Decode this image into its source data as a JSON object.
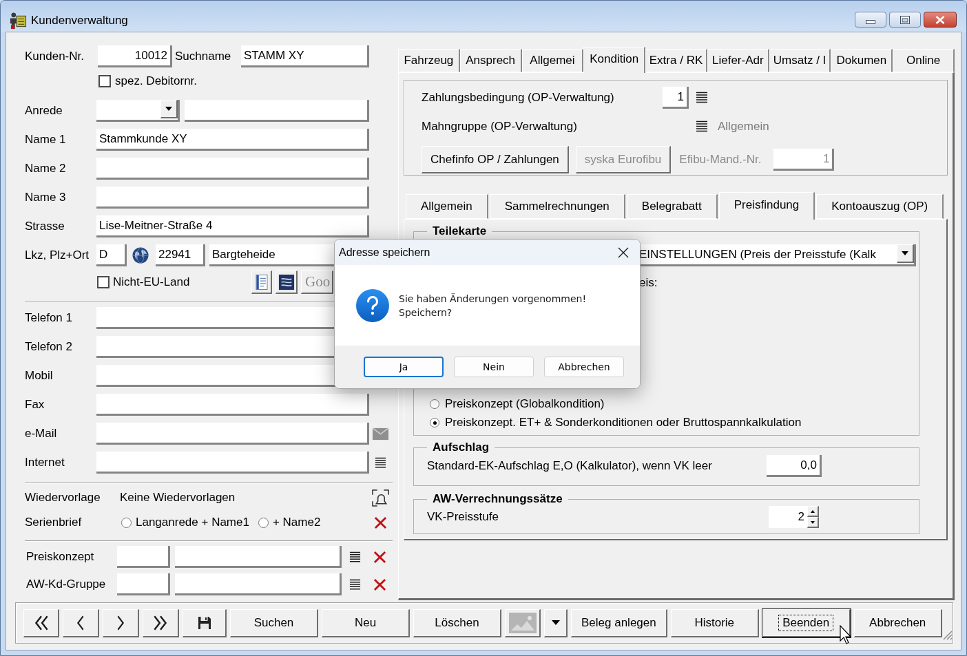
{
  "window": {
    "title": "Kundenverwaltung"
  },
  "customer": {
    "customer_number": {
      "label": "Kunden-Nr.",
      "value": "10012"
    },
    "search_name": {
      "label": "Suchname",
      "value": "STAMM XY"
    },
    "special_debtor_number": {
      "label": "spez. Debitornr.",
      "checked": false
    },
    "salutation": {
      "label": "Anrede"
    },
    "names": [
      {
        "label": "Name 1",
        "value": "Stammkunde XY"
      },
      {
        "label": "Name 2"
      },
      {
        "label": "Name 3"
      }
    ],
    "street": {
      "label": "Strasse",
      "value": "Lise-Meitner-Straße 4"
    },
    "location": {
      "label": "Lkz, Plz+Ort",
      "country_code": "D",
      "postal_code": "22941",
      "city": "Bargteheide"
    },
    "non_eu_country": {
      "label": "Nicht-EU-Land",
      "checked": false
    },
    "map_link": {
      "label": "Goo"
    },
    "contacts": [
      {
        "label": "Telefon 1",
        "kind": "phone"
      },
      {
        "label": "Telefon 2",
        "kind": "phone"
      },
      {
        "label": "Mobil",
        "kind": "phone"
      },
      {
        "label": "Fax",
        "kind": "phone"
      },
      {
        "label": "e-Mail",
        "kind": "email"
      },
      {
        "label": "Internet",
        "kind": "web"
      }
    ],
    "follow_up": {
      "label": "Wiedervorlage",
      "value": "Keine Wiedervorlagen"
    },
    "serial_letter": {
      "label": "Serienbrief",
      "options": [
        {
          "label": "Langanrede + Name1",
          "selected": false
        },
        {
          "label": "+ Name2",
          "selected": false
        }
      ]
    },
    "lookups": [
      {
        "label": "Preiskonzept"
      },
      {
        "label": "AW-Kd-Gruppe"
      }
    ]
  },
  "tabs": [
    {
      "label": "Fahrzeug",
      "selected": false
    },
    {
      "label": "Ansprech",
      "selected": false
    },
    {
      "label": "Allgemei",
      "selected": false
    },
    {
      "label": "Kondition",
      "selected": true
    },
    {
      "label": "Extra / RK",
      "selected": false
    },
    {
      "label": "Liefer-Adr",
      "selected": false
    },
    {
      "label": "Umsatz / I",
      "selected": false
    },
    {
      "label": "Dokumen",
      "selected": false
    },
    {
      "label": "Online",
      "selected": false
    }
  ],
  "payment": {
    "terms": {
      "label": "Zahlungsbedingung (OP-Verwaltung)",
      "value": "1"
    },
    "dunning_group": {
      "label": "Mahngruppe (OP-Verwaltung)",
      "value": "Allgemein"
    },
    "buttons": [
      {
        "label": "Chefinfo OP / Zahlungen",
        "disabled": false
      },
      {
        "label": "syska Eurofibu",
        "disabled": true
      }
    ],
    "accounting_client": {
      "label": "Efibu-Mand.-Nr.",
      "value": "1",
      "disabled": true
    }
  },
  "sub_tabs": [
    {
      "label": "Allgemein",
      "selected": false
    },
    {
      "label": "Sammelrechnungen",
      "selected": false
    },
    {
      "label": "Belegrabatt",
      "selected": false
    },
    {
      "label": "Preisfindung",
      "selected": true
    },
    {
      "label": "Kontoauszug (OP)",
      "selected": false
    }
  ],
  "parts_card": {
    "title": "Teilekarte",
    "dropdown_value": "EINSTELLUNGEN (Preis der Preisstufe (Kalk",
    "text_fragment": "eis:",
    "options": [
      {
        "label": "Preiskonzept (Globalkondition)",
        "selected": false
      },
      {
        "label": "Preiskonzept. ET+ & Sonderkonditionen oder Bruttospannkalkulation",
        "selected": true
      }
    ]
  },
  "surcharge": {
    "title": "Aufschlag",
    "label": "Standard-EK-Aufschlag E,O (Kalkulator), wenn VK leer",
    "value": "0,0"
  },
  "labour_rates": {
    "title": "AW-Verrechnungssätze",
    "label": "VK-Preisstufe",
    "value": "2"
  },
  "toolbar": [
    {
      "kind": "first",
      "focused": false
    },
    {
      "kind": "previous",
      "focused": false
    },
    {
      "kind": "next",
      "focused": false
    },
    {
      "kind": "last",
      "focused": false
    },
    {
      "kind": "save",
      "focused": false
    },
    {
      "kind": "text",
      "label": "Suchen",
      "focused": false
    },
    {
      "kind": "text",
      "label": "Neu",
      "focused": false
    },
    {
      "kind": "text",
      "label": "Löschen",
      "focused": false
    },
    {
      "kind": "picture",
      "focused": false
    },
    {
      "kind": "dropdown",
      "focused": false
    },
    {
      "kind": "text",
      "label": "Beleg anlegen",
      "focused": false
    },
    {
      "kind": "text",
      "label": "Historie",
      "focused": false
    },
    {
      "kind": "text",
      "label": "Beenden",
      "focused": true
    },
    {
      "kind": "text",
      "label": "Abbrechen",
      "focused": false
    }
  ],
  "dialog": {
    "title": "Adresse speichern",
    "message": "Sie haben Änderungen vorgenommen!\nSpeichern?",
    "buttons": [
      {
        "label": "Ja",
        "default": true
      },
      {
        "label": "Nein",
        "default": false
      },
      {
        "label": "Abbrechen",
        "default": false
      }
    ]
  }
}
